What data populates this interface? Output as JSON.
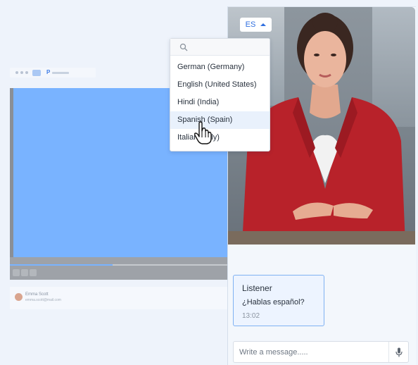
{
  "editor": {
    "owner_name": "Emma Scott",
    "owner_email": "emma.scott@mail.com"
  },
  "video": {
    "language_code": "ES",
    "caret_icon": "caret-up-icon"
  },
  "language_dropdown": {
    "search_placeholder": "",
    "options": [
      {
        "label": "German (Germany)",
        "selected": false
      },
      {
        "label": "English (United States)",
        "selected": false
      },
      {
        "label": "Hindi (India)",
        "selected": false
      },
      {
        "label": "Spanish (Spain)",
        "selected": true
      },
      {
        "label": "Italian (Italy)",
        "selected": false
      }
    ]
  },
  "chat": {
    "message": {
      "sender": "Listener",
      "text": "¿Hablas español?",
      "time": "13:02"
    },
    "composer": {
      "placeholder": "Write a message....."
    }
  },
  "colors": {
    "accent": "#2f6fe0",
    "selected_row": "#e9f1fc",
    "message_border": "#7fb1f2"
  }
}
